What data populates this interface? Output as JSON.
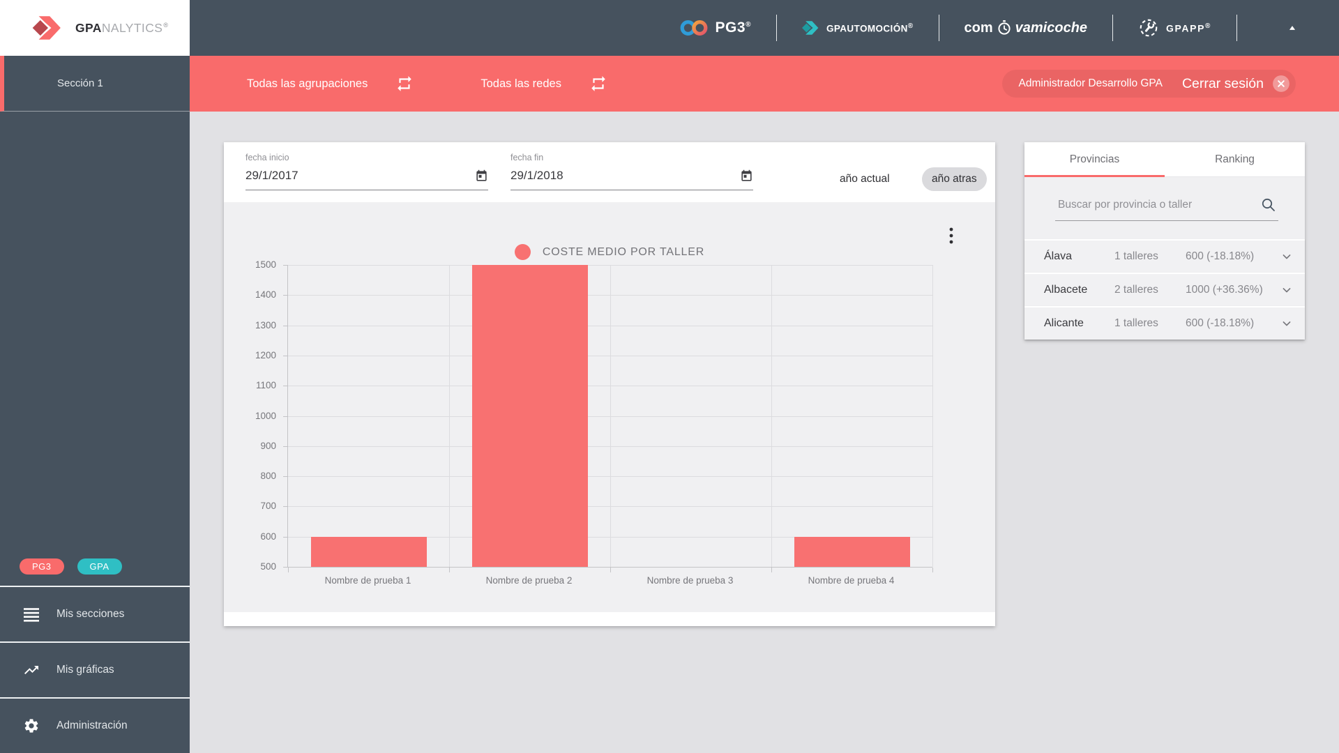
{
  "sidebar": {
    "logo": {
      "bold": "GPA",
      "light": "NALYTICS",
      "reg": "®"
    },
    "section_label": "Sección 1",
    "badges": [
      {
        "label": "PG3",
        "color": "#f96b6b"
      },
      {
        "label": "GPA",
        "color": "#2fbfc4"
      }
    ],
    "items": [
      {
        "label": "Mis secciones",
        "icon": "list"
      },
      {
        "label": "Mis gráficas",
        "icon": "chart"
      },
      {
        "label": "Administración",
        "icon": "gear"
      }
    ]
  },
  "topbar": {
    "pg3": {
      "label": "PG3",
      "reg": "®"
    },
    "gpautomocion": {
      "label": "GPAUTOMOCIÓN",
      "reg": "®"
    },
    "comprobamicoche": {
      "pre": "com",
      "post": "vamicoche"
    },
    "gpapp": {
      "label": "GPAPP",
      "reg": "®"
    }
  },
  "filterbar": {
    "agrupaciones": "Todas las agrupaciones",
    "redes": "Todas las redes",
    "user": "Administrador Desarrollo GPA",
    "logout": "Cerrar sesión"
  },
  "toolbar": {
    "fecha_inicio_label": "fecha inicio",
    "fecha_inicio_value": "29/1/2017",
    "fecha_fin_label": "fecha fin",
    "fecha_fin_value": "29/1/2018",
    "year_current": "año actual",
    "year_back": "año atras"
  },
  "chart_data": {
    "type": "bar",
    "title": "COSTE MEDIO POR TALLER",
    "categories": [
      "Nombre de prueba 1",
      "Nombre de prueba 2",
      "Nombre de prueba 3",
      "Nombre de prueba 4"
    ],
    "values": [
      600,
      1500,
      null,
      600
    ],
    "ylim": [
      500,
      1500
    ],
    "ytick_step": 100,
    "xlabel": "",
    "ylabel": "",
    "bar_color": "#f87171",
    "grid": true,
    "legend_position": "top"
  },
  "panel": {
    "tabs": [
      {
        "label": "Provincias",
        "active": true
      },
      {
        "label": "Ranking",
        "active": false
      }
    ],
    "search_placeholder": "Buscar por provincia o taller",
    "rows": [
      {
        "name": "Álava",
        "talleres": "1 talleres",
        "value": "600 (-18.18%)"
      },
      {
        "name": "Albacete",
        "talleres": "2 talleres",
        "value": "1000 (+36.36%)"
      },
      {
        "name": "Alicante",
        "talleres": "1 talleres",
        "value": "600 (-18.18%)"
      }
    ]
  },
  "colors": {
    "header_bg": "#46525e",
    "accent_red": "#f96b6b",
    "accent_teal": "#2fbfc4",
    "page_bg": "#e1e1e4",
    "panel_gray": "#f0f0f2"
  }
}
